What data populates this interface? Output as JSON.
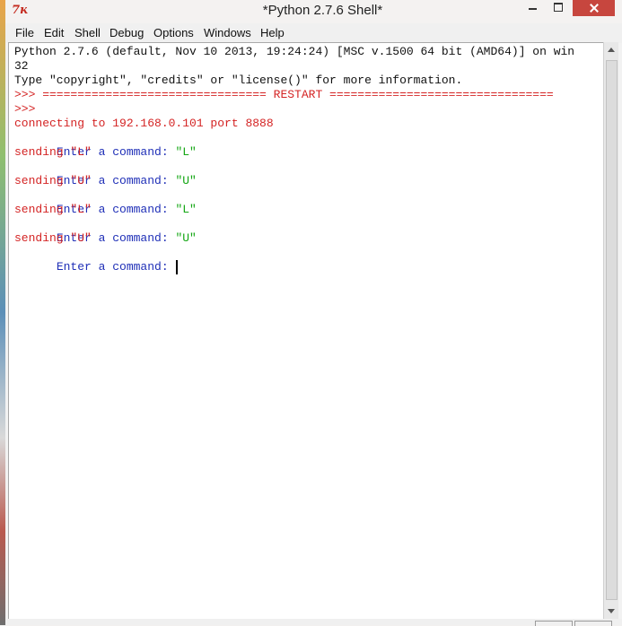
{
  "window": {
    "title": "*Python 2.7.6 Shell*",
    "app_icon": "7ĸ"
  },
  "menu": {
    "items": [
      "File",
      "Edit",
      "Shell",
      "Debug",
      "Options",
      "Windows",
      "Help"
    ]
  },
  "shell": {
    "lines": [
      "Python 2.7.6 (default, Nov 10 2013, 19:24:24) [MSC v.1500 64 bit (AMD64)] on win",
      "32",
      "Type \"copyright\", \"credits\" or \"license()\" for more information.",
      ">>> ================================ RESTART ================================",
      ">>>",
      "connecting to 192.168.0.101 port 8888",
      "Enter a command: ",
      "\"L\"",
      "sending \"L\"",
      "Enter a command: ",
      "\"U\"",
      "sending \"U\"",
      "Enter a command: ",
      "\"L\"",
      "sending \"L\"",
      "Enter a command: ",
      "\"U\"",
      "sending \"U\"",
      "Enter a command: "
    ]
  },
  "colors": {
    "stdout": "#111111",
    "stderr_red": "#d42424",
    "prompt_blue": "#1f2fb7",
    "input_green": "#13a613",
    "close_button": "#c7463e"
  }
}
